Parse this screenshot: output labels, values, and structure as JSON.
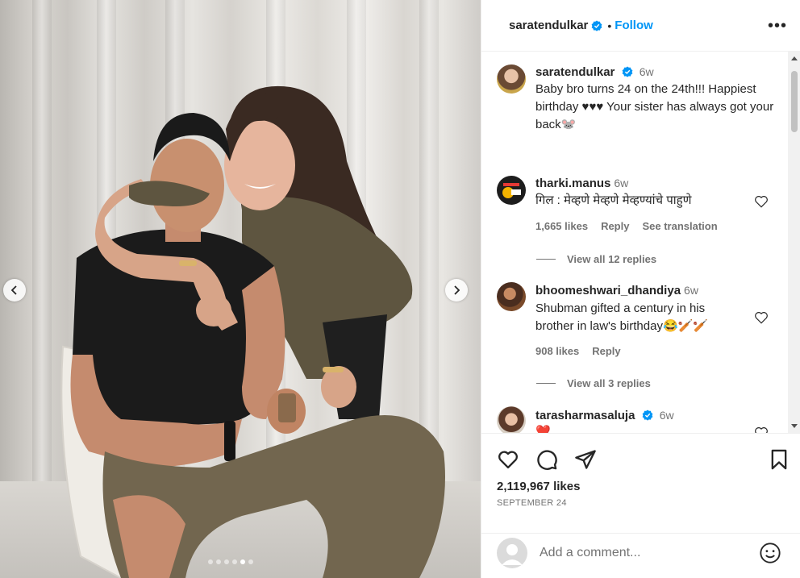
{
  "post": {
    "author": "saratendulkar",
    "follow_label": "Follow",
    "separator": "•",
    "more_label": "•••",
    "verified": true
  },
  "caption": {
    "username": "saratendulkar",
    "time": "6w",
    "text": "Baby bro turns 24 on the 24th!!! Happiest birthday ♥♥♥ Your sister has always got your back🐭"
  },
  "comments": [
    {
      "username": "tharki.manus",
      "time": "6w",
      "text": "गिल : मेव्हणे मेव्हणे मेव्हण्यांचे पाहुणे",
      "likes": "1,665 likes",
      "reply_label": "Reply",
      "translate_label": "See translation",
      "view_replies": "View all 12 replies"
    },
    {
      "username": "bhoomeshwari_dhandiya",
      "time": "6w",
      "text": "Shubman gifted a century in his brother in law's birthday😂🏏🏏",
      "likes": "908 likes",
      "reply_label": "Reply",
      "view_replies": "View all 3 replies"
    },
    {
      "username": "tarasharmasaluja",
      "time": "6w",
      "text": "❤️",
      "verified": true
    }
  ],
  "actions": {
    "like_icon": "heart-icon",
    "comment_icon": "comment-icon",
    "share_icon": "send-icon",
    "save_icon": "bookmark-icon",
    "likes_count": "2,119,967 likes",
    "date": "SEPTEMBER 24"
  },
  "add_comment": {
    "placeholder": "Add a comment..."
  },
  "carousel": {
    "total": 6,
    "current": 5
  },
  "colors": {
    "accent": "#0095f6",
    "verified": "#0095f6",
    "muted": "#737373",
    "text": "#262626"
  }
}
